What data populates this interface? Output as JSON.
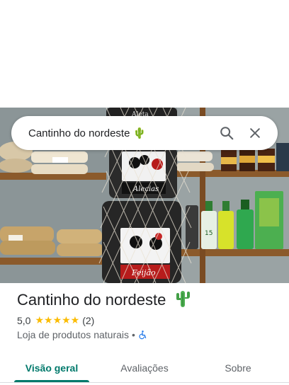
{
  "search": {
    "query": "Cantinho do nordeste",
    "query_emoji": "🌵",
    "search_icon": "search-icon",
    "close_icon": "close-icon"
  },
  "photo": {
    "label_top": "Aleta",
    "label_mid": "Alecias",
    "label_bottom": "Feijão",
    "bottle_label": "15"
  },
  "place": {
    "name": "Cantinho do nordeste",
    "rating": "5,0",
    "stars": "★★★★★",
    "review_count": "(2)",
    "category": "Loja de produtos naturais",
    "separator": "•",
    "accessibility_icon": "wheelchair-icon"
  },
  "tabs": [
    {
      "label": "Visão geral",
      "active": true
    },
    {
      "label": "Avaliações",
      "active": false
    },
    {
      "label": "Sobre",
      "active": false
    }
  ],
  "colors": {
    "accent": "#00796b",
    "star": "#fbbc04",
    "accessibility": "#1a73e8",
    "cactus": "#4caf50"
  }
}
